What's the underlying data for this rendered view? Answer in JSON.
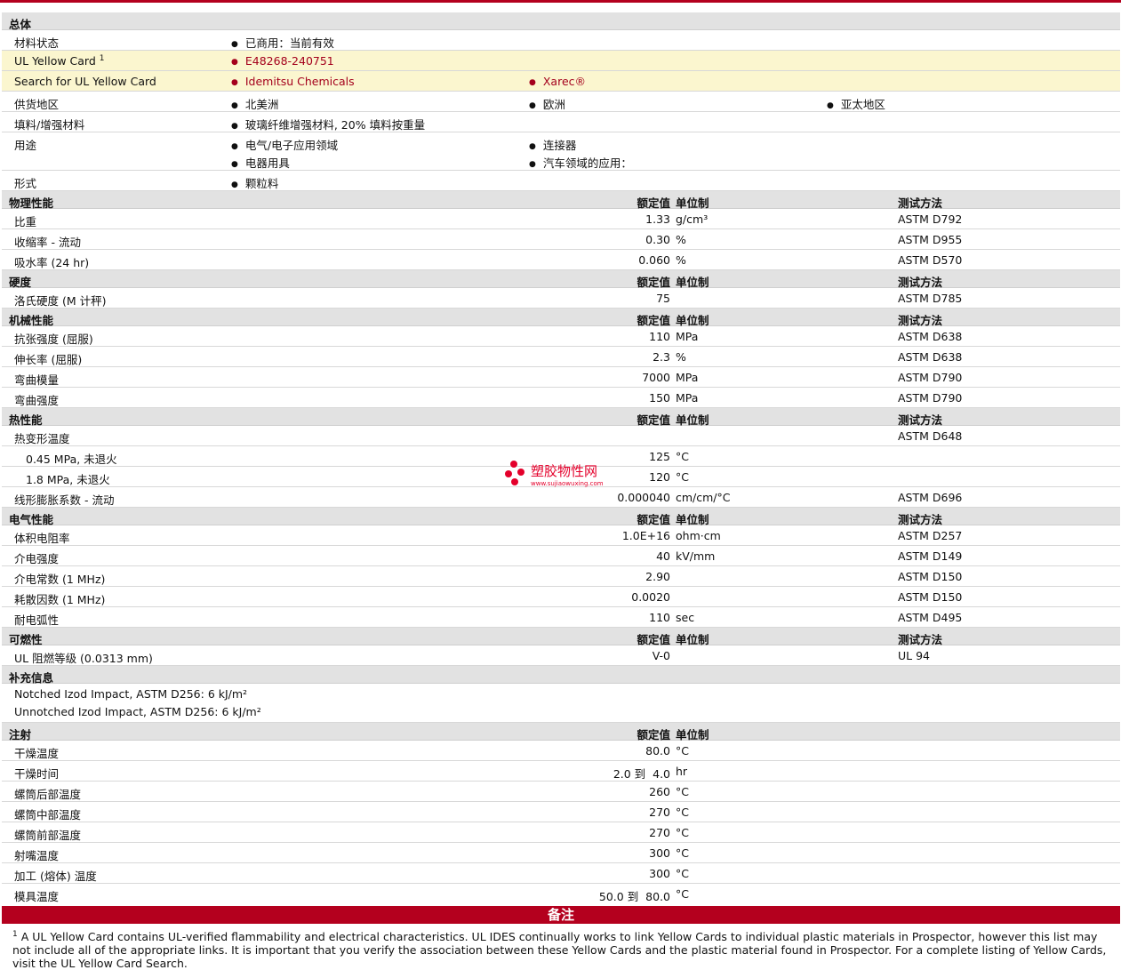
{
  "general": {
    "section_title": "总体",
    "material_status": {
      "label": "材料状态",
      "value": "已商用：当前有效"
    },
    "ul_card": {
      "label": "UL Yellow Card",
      "sup": "1",
      "value": "E48268-240751"
    },
    "ul_search": {
      "label": "Search for UL Yellow Card",
      "values": [
        "Idemitsu Chemicals",
        "Xarec®"
      ]
    },
    "supply": {
      "label": "供货地区",
      "values": [
        "北美洲",
        "欧洲",
        "亚太地区"
      ]
    },
    "filler": {
      "label": "填料/增强材料",
      "value": "玻璃纤维增强材料, 20% 填料按重量"
    },
    "uses": {
      "label": "用途",
      "values": [
        "电气/电子应用领域",
        "连接器",
        "电器用具",
        "汽车领域的应用："
      ]
    },
    "form": {
      "label": "形式",
      "value": "颗粒料"
    }
  },
  "headers": {
    "nominal": "额定值",
    "unit": "单位制",
    "test": "测试方法"
  },
  "physical": {
    "title": "物理性能",
    "rows": [
      {
        "name": "比重",
        "value": "1.33",
        "unit": "g/cm³",
        "test": "ASTM D792"
      },
      {
        "name": "收缩率 - 流动",
        "value": "0.30",
        "unit": "%",
        "test": "ASTM D955"
      },
      {
        "name": "吸水率 (24 hr)",
        "value": "0.060",
        "unit": "%",
        "test": "ASTM D570"
      }
    ]
  },
  "hardness": {
    "title": "硬度",
    "rows": [
      {
        "name": "洛氏硬度 (M 计秤)",
        "value": "75",
        "unit": "",
        "test": "ASTM D785"
      }
    ]
  },
  "mechanical": {
    "title": "机械性能",
    "rows": [
      {
        "name": "抗张强度 (屈服)",
        "value": "110",
        "unit": "MPa",
        "test": "ASTM D638"
      },
      {
        "name": "伸长率 (屈服)",
        "value": "2.3",
        "unit": "%",
        "test": "ASTM D638"
      },
      {
        "name": "弯曲模量",
        "value": "7000",
        "unit": "MPa",
        "test": "ASTM D790"
      },
      {
        "name": "弯曲强度",
        "value": "150",
        "unit": "MPa",
        "test": "ASTM D790"
      }
    ]
  },
  "thermal": {
    "title": "热性能",
    "hdt": {
      "name": "热变形温度",
      "test": "ASTM D648"
    },
    "hdt_rows": [
      {
        "name": "0.45 MPa, 未退火",
        "value": "125",
        "unit": "°C"
      },
      {
        "name": "1.8 MPa, 未退火",
        "value": "120",
        "unit": "°C"
      }
    ],
    "clte": {
      "name": "线形膨胀系数 - 流动",
      "value": "0.000040",
      "unit": "cm/cm/°C",
      "test": "ASTM D696"
    }
  },
  "electrical": {
    "title": "电气性能",
    "rows": [
      {
        "name": "体积电阻率",
        "value": "1.0E+16",
        "unit": "ohm·cm",
        "test": "ASTM D257"
      },
      {
        "name": "介电强度",
        "value": "40",
        "unit": "kV/mm",
        "test": "ASTM D149"
      },
      {
        "name": "介电常数 (1 MHz)",
        "value": "2.90",
        "unit": "",
        "test": "ASTM D150"
      },
      {
        "name": "耗散因数 (1 MHz)",
        "value": "0.0020",
        "unit": "",
        "test": "ASTM D150"
      },
      {
        "name": "耐电弧性",
        "value": "110",
        "unit": "sec",
        "test": "ASTM D495"
      }
    ]
  },
  "flammability": {
    "title": "可燃性",
    "rows": [
      {
        "name": "UL 阻燃等级 (0.0313 mm)",
        "value": "V-0",
        "unit": "",
        "test": "UL 94"
      }
    ]
  },
  "supplement": {
    "title": "补充信息",
    "lines": [
      "Notched Izod Impact, ASTM D256: 6 kJ/m²",
      "Unnotched Izod Impact, ASTM D256: 6 kJ/m²"
    ]
  },
  "injection": {
    "title": "注射",
    "rows": [
      {
        "name": "干燥温度",
        "value": "80.0",
        "unit": "°C"
      },
      {
        "name": "干燥时间",
        "value": "2.0 到  4.0",
        "unit": "hr"
      },
      {
        "name": "螺筒后部温度",
        "value": "260",
        "unit": "°C"
      },
      {
        "name": "螺筒中部温度",
        "value": "270",
        "unit": "°C"
      },
      {
        "name": "螺筒前部温度",
        "value": "270",
        "unit": "°C"
      },
      {
        "name": "射嘴温度",
        "value": "300",
        "unit": "°C"
      },
      {
        "name": "加工 (熔体) 温度",
        "value": "300",
        "unit": "°C"
      },
      {
        "name": "模具温度",
        "value": "50.0 到  80.0",
        "unit": "°C"
      }
    ]
  },
  "notes": {
    "title": "备注",
    "sup": "1",
    "text": "A UL Yellow Card contains UL-verified flammability and electrical characteristics. UL IDES continually works to link Yellow Cards to individual plastic materials in Prospector, however this list may not include all of the appropriate links. It is important that you verify the association between these Yellow Cards and the plastic material found in Prospector. For a complete listing of Yellow Cards, visit the UL Yellow Card Search."
  },
  "watermark": {
    "cn": "塑胶物性网",
    "en": "www.sujiaowuxing.com"
  }
}
